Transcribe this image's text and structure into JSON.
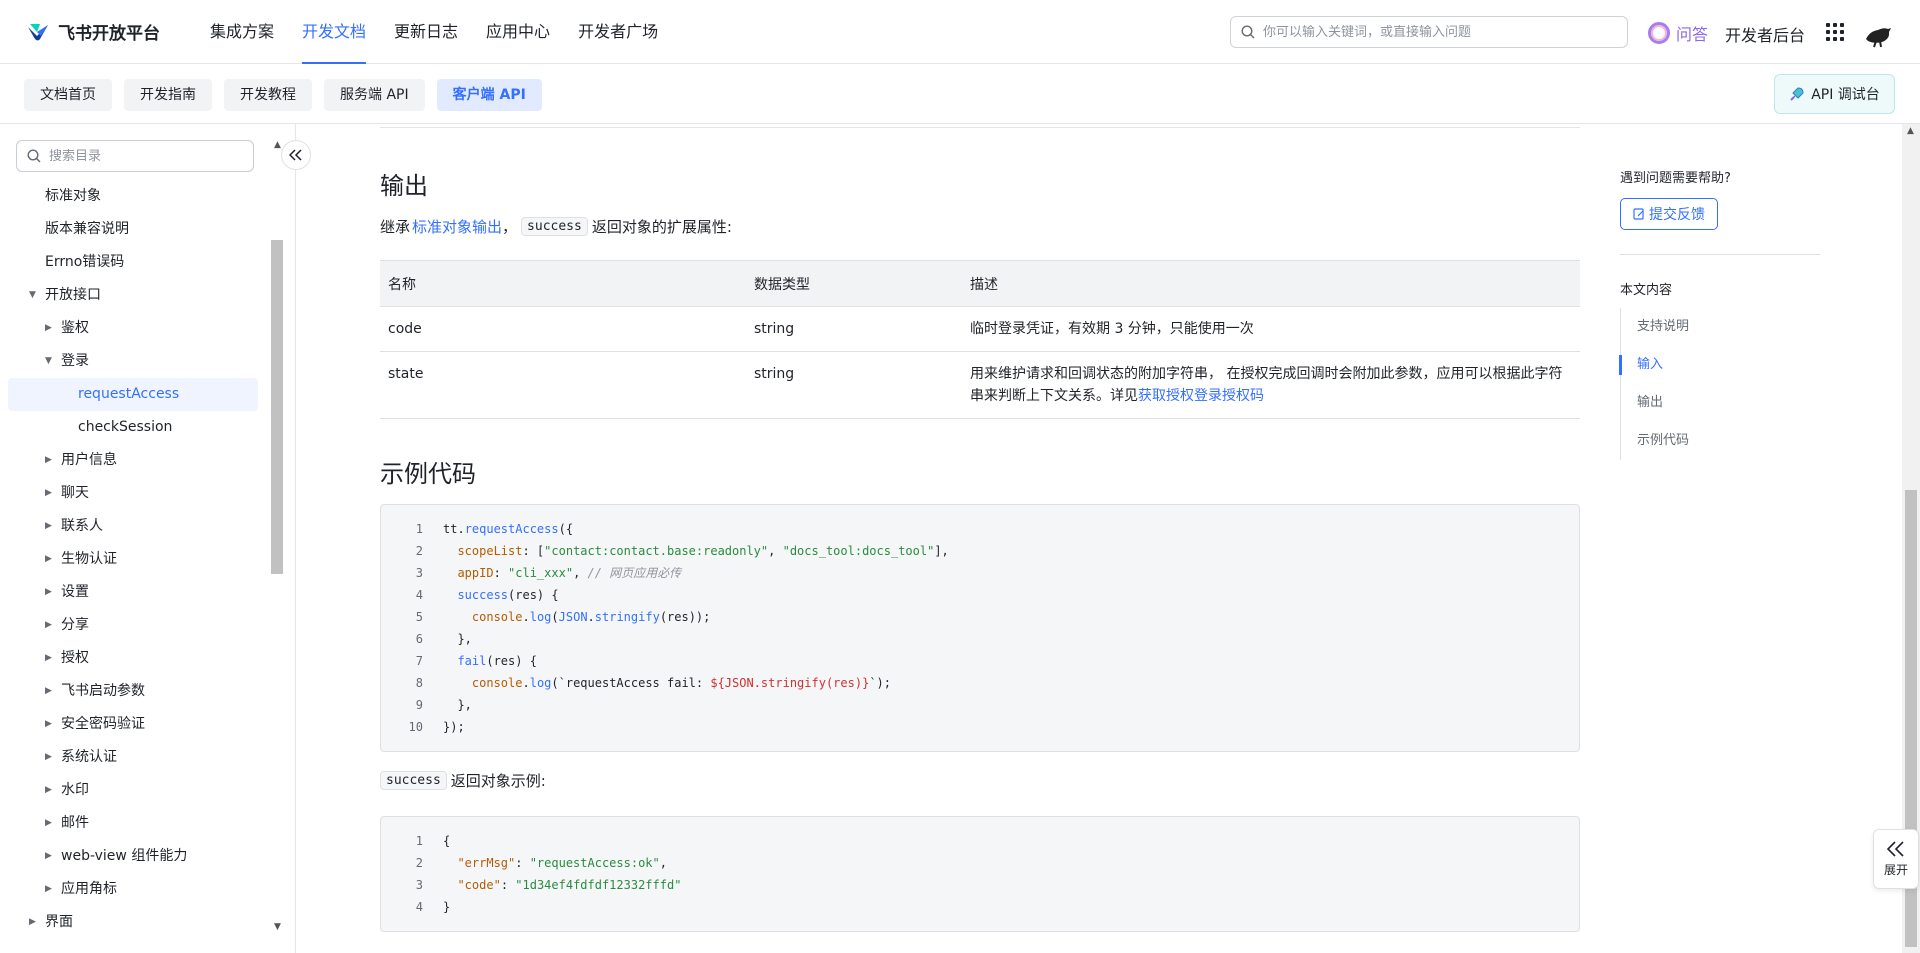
{
  "header": {
    "brand": "飞书开放平台",
    "nav": [
      "集成方案",
      "开发文档",
      "更新日志",
      "应用中心",
      "开发者广场"
    ],
    "nav_active_index": 1,
    "search_placeholder": "你可以输入关键词，或直接输入问题",
    "ask_label": "问答",
    "console_label": "开发者后台"
  },
  "subnav": {
    "tabs": [
      "文档首页",
      "开发指南",
      "开发教程",
      "服务端 API",
      "客户端 API"
    ],
    "active_index": 4,
    "api_debug_label": "API 调试台"
  },
  "sidebar": {
    "search_placeholder": "搜索目录",
    "items": [
      {
        "label": "标准对象",
        "level": 1,
        "caret": ""
      },
      {
        "label": "版本兼容说明",
        "level": 1,
        "caret": ""
      },
      {
        "label": "Errno错误码",
        "level": 1,
        "caret": ""
      },
      {
        "label": "开放接口",
        "level": 1,
        "caret": "down"
      },
      {
        "label": "鉴权",
        "level": 2,
        "caret": "right"
      },
      {
        "label": "登录",
        "level": 2,
        "caret": "down"
      },
      {
        "label": "requestAccess",
        "level": 3,
        "caret": "",
        "selected": true
      },
      {
        "label": "checkSession",
        "level": 3,
        "caret": ""
      },
      {
        "label": "用户信息",
        "level": 2,
        "caret": "right"
      },
      {
        "label": "聊天",
        "level": 2,
        "caret": "right"
      },
      {
        "label": "联系人",
        "level": 2,
        "caret": "right"
      },
      {
        "label": "生物认证",
        "level": 2,
        "caret": "right"
      },
      {
        "label": "设置",
        "level": 2,
        "caret": "right"
      },
      {
        "label": "分享",
        "level": 2,
        "caret": "right"
      },
      {
        "label": "授权",
        "level": 2,
        "caret": "right"
      },
      {
        "label": "飞书启动参数",
        "level": 2,
        "caret": "right"
      },
      {
        "label": "安全密码验证",
        "level": 2,
        "caret": "right"
      },
      {
        "label": "系统认证",
        "level": 2,
        "caret": "right"
      },
      {
        "label": "水印",
        "level": 2,
        "caret": "right"
      },
      {
        "label": "邮件",
        "level": 2,
        "caret": "right"
      },
      {
        "label": "web-view 组件能力",
        "level": 2,
        "caret": "right"
      },
      {
        "label": "应用角标",
        "level": 2,
        "caret": "right"
      },
      {
        "label": "界面",
        "level": 1,
        "caret": "right"
      }
    ]
  },
  "content": {
    "output_heading": "输出",
    "inherit_prefix": "继承",
    "inherit_link": "标准对象输出",
    "inherit_sep": "，",
    "inherit_code": "success",
    "inherit_suffix": "返回对象的扩展属性:",
    "table": {
      "headers": [
        "名称",
        "数据类型",
        "描述"
      ],
      "rows": [
        {
          "name": "code",
          "type": "string",
          "desc": "临时登录凭证，有效期 3 分钟，只能使用一次",
          "link": ""
        },
        {
          "name": "state",
          "type": "string",
          "desc": "用来维护请求和回调状态的附加字符串， 在授权完成回调时会附加此参数，应用可以根据此字符串来判断上下文关系。详见",
          "link": "获取授权登录授权码"
        }
      ]
    },
    "example_heading": "示例代码",
    "code1_lines": [
      "tt.requestAccess({",
      "  scopeList: [\"contact:contact.base:readonly\", \"docs_tool:docs_tool\"],",
      "  appID: \"cli_xxx\", // 网页应用必传",
      "  success(res) {",
      "    console.log(JSON.stringify(res));",
      "  },",
      "  fail(res) {",
      "    console.log(`requestAccess fail: ${JSON.stringify(res)}`);",
      "  },",
      "});"
    ],
    "success_code": "success",
    "success_suffix": "返回对象示例:",
    "code2_lines": [
      "{",
      "  \"errMsg\": \"requestAccess:ok\",",
      "  \"code\": \"1d34ef4fdfdf12332fffd\"",
      "}"
    ]
  },
  "toc": {
    "help_text": "遇到问题需要帮助?",
    "feedback_label": "提交反馈",
    "title": "本文内容",
    "items": [
      "支持说明",
      "输入",
      "输出",
      "示例代码"
    ],
    "active_index": 1
  },
  "expand_label": "展开",
  "colors": {
    "accent": "#3370ff",
    "border": "#dee0e3",
    "code_bg": "#f5f6f7"
  }
}
